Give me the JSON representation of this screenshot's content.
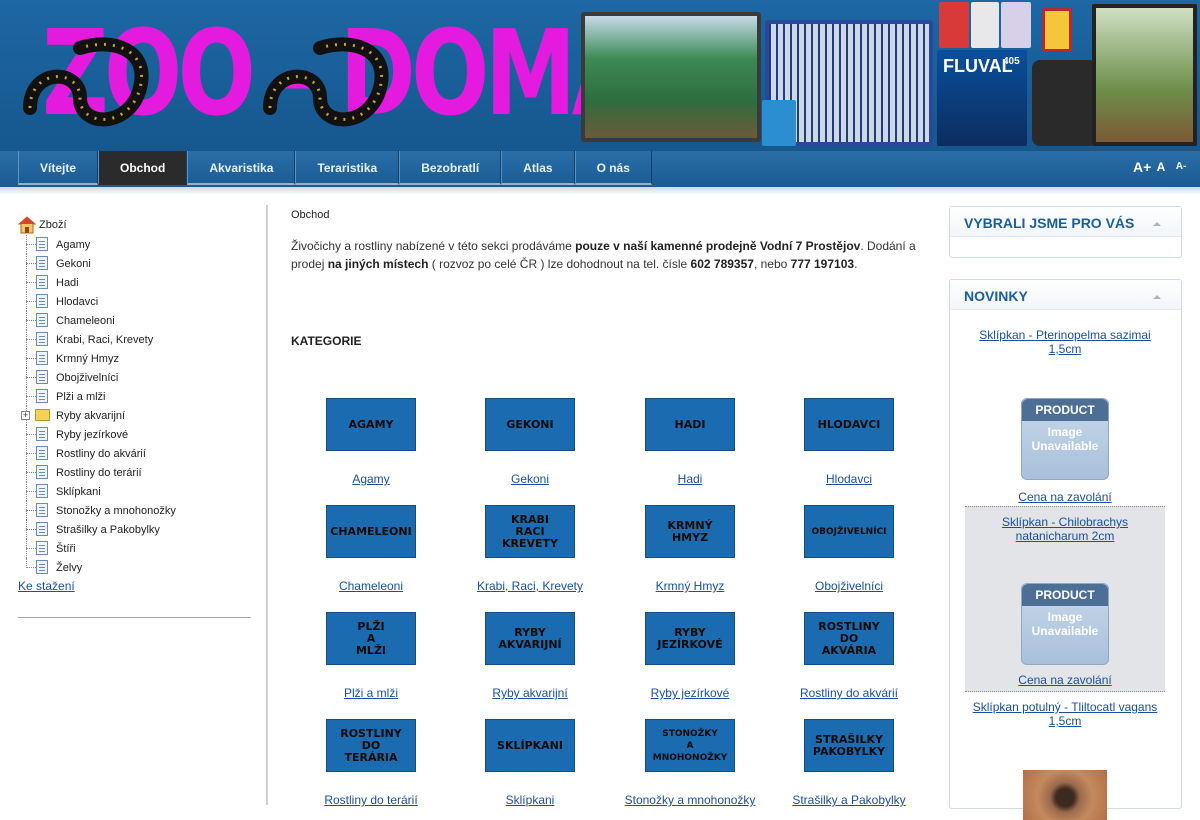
{
  "logo": {
    "text": "ZOO - DOMA"
  },
  "banner": {
    "fluval_label": "FLUVAL",
    "fluval_model": "405"
  },
  "nav": {
    "items": [
      {
        "label": "Vítejte",
        "active": false
      },
      {
        "label": "Obchod",
        "active": true
      },
      {
        "label": "Akvaristika",
        "active": false
      },
      {
        "label": "Teraristika",
        "active": false
      },
      {
        "label": "Bezobratlí",
        "active": false
      },
      {
        "label": "Atlas",
        "active": false
      },
      {
        "label": "O nás",
        "active": false
      }
    ],
    "font_size_buttons": [
      "A+",
      "A",
      "A-"
    ]
  },
  "sidebar": {
    "root": "Zboží",
    "items": [
      {
        "label": "Agamy",
        "type": "doc"
      },
      {
        "label": "Gekoni",
        "type": "doc"
      },
      {
        "label": "Hadi",
        "type": "doc"
      },
      {
        "label": "Hlodavci",
        "type": "doc"
      },
      {
        "label": "Chameleoni",
        "type": "doc"
      },
      {
        "label": "Krabi, Raci, Krevety",
        "type": "doc"
      },
      {
        "label": "Krmný Hmyz",
        "type": "doc"
      },
      {
        "label": "Obojživelníci",
        "type": "doc"
      },
      {
        "label": "Plži a mlži",
        "type": "doc"
      },
      {
        "label": "Ryby akvarijní",
        "type": "folder"
      },
      {
        "label": "Ryby jezírkové",
        "type": "doc"
      },
      {
        "label": "Rostliny do akvárií",
        "type": "doc"
      },
      {
        "label": "Rostliny do terárií",
        "type": "doc"
      },
      {
        "label": "Sklípkani",
        "type": "doc"
      },
      {
        "label": "Stonožky a mnohonožky",
        "type": "doc"
      },
      {
        "label": "Strašilky a Pakobylky",
        "type": "doc"
      },
      {
        "label": "Štíři",
        "type": "doc"
      },
      {
        "label": "Želvy",
        "type": "doc"
      }
    ],
    "downloads": "Ke stažení"
  },
  "main": {
    "breadcrumb": "Obchod",
    "intro": {
      "p1": "Živočichy a rostliny nabízené v této sekci prodáváme ",
      "b1": "pouze v naší kamenné prodejně Vodní 7 Prostějov",
      "p2": ". Dodání a prodej ",
      "b2": "na jiných místech",
      "p3": " ( rozvoz po celé ČR ) lze dohodnout na tel. čísle ",
      "b3": "602 789357",
      "p4": ", nebo ",
      "b4": "777 197103",
      "p5": "."
    },
    "categories_title": "KATEGORIE",
    "categories": [
      {
        "tile": "AGAMY",
        "link": "Agamy"
      },
      {
        "tile": "GEKONI",
        "link": "Gekoni"
      },
      {
        "tile": "HADI",
        "link": "Hadi"
      },
      {
        "tile": "HLODAVCI",
        "link": "Hlodavci"
      },
      {
        "tile": "CHAMELEONI",
        "link": "Chameleoni"
      },
      {
        "tile": "KRABI\nRACI\nKREVETY",
        "link": "Krabi, Raci, Krevety"
      },
      {
        "tile": "KRMNÝ\nHMYZ",
        "link": "Krmný Hmyz"
      },
      {
        "tile": "OBOJŽIVELNÍCI",
        "link": "Obojživelníci"
      },
      {
        "tile": "PLŽI\nA\nMLŽI",
        "link": "Plži a mlži"
      },
      {
        "tile": "RYBY\nAKVARIJNÍ",
        "link": "Ryby akvarijní"
      },
      {
        "tile": "RYBY\nJEZÍRKOVÉ",
        "link": "Ryby jezírkové"
      },
      {
        "tile": "ROSTLINY\nDO\nAKVÁRIA",
        "link": "Rostliny do akvárií"
      },
      {
        "tile": "ROSTLINY\nDO\nTERÁRIA",
        "link": "Rostliny do terárií"
      },
      {
        "tile": "SKLÍPKANI",
        "link": "Sklípkani"
      },
      {
        "tile": "STONOŽKY\nA\nMNOHONOŽKY",
        "link": "Stonožky a mnohonožky"
      },
      {
        "tile": "STRAŠILKY\nPAKOBYLKY",
        "link": "Strašilky a Pakobylky"
      }
    ]
  },
  "right": {
    "picks_title": "VYBRALI JSME PRO VÁS",
    "news_title": "NOVINKY",
    "products": [
      {
        "name": "Sklípkan - Pterinopelma sazimai 1,5cm",
        "price": "Cena na zavolání"
      },
      {
        "name": "Sklípkan - Chilobrachys natanicharum 2cm",
        "price": "Cena na zavolání"
      },
      {
        "name": "Sklípkan potulný - Tliltocatl vagans 1,5cm",
        "price": ""
      }
    ],
    "placeholder_top": "PRODUCT",
    "placeholder_body": "Image\nUnavailable"
  },
  "colors": {
    "accent": "#1a5ea2",
    "header_bg": "#1d67a4",
    "logo": "#e51adf",
    "tile": "#1b6bb0",
    "link": "#1a4fa0"
  }
}
